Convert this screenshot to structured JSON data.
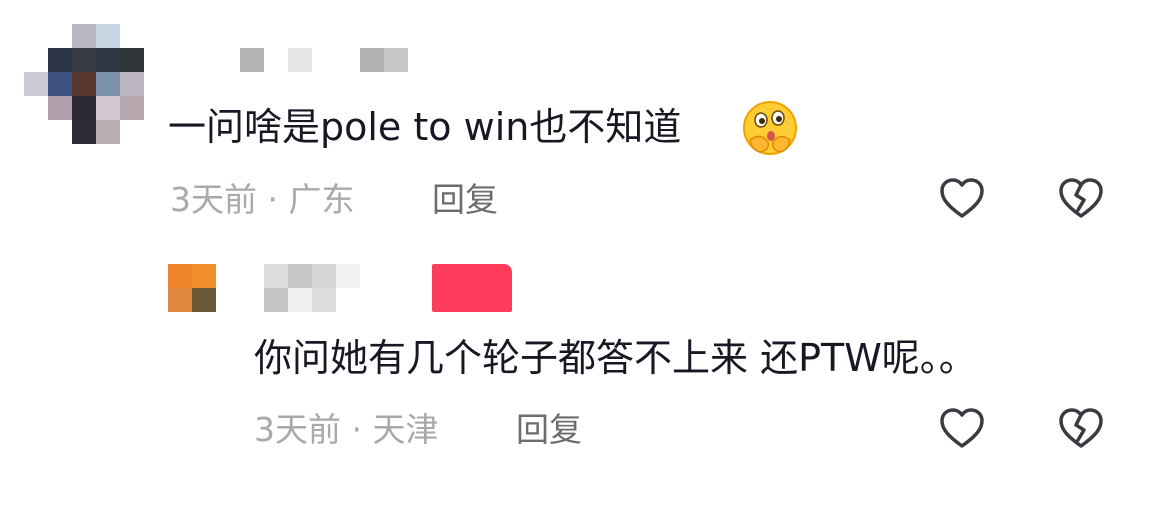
{
  "comments": [
    {
      "avatar": "pixelated-avatar",
      "username_hidden": true,
      "text": "一问啥是pole to win也不知道",
      "emoji": "thinking-kiss-emoji",
      "time": "3天前",
      "separator": "·",
      "location": "广东",
      "reply_label": "回复"
    },
    {
      "avatar": "pixelated-avatar-orange",
      "username_hidden": true,
      "text": "你问她有几个轮子都答不上来 还PTW呢。。",
      "time": "3天前",
      "separator": "·",
      "location": "天津",
      "reply_label": "回复"
    }
  ],
  "icons": {
    "like": "heart-outline-icon",
    "dislike": "broken-heart-icon"
  },
  "colors": {
    "text": "#161823",
    "meta": "#a8a8ad",
    "reply": "#6b6b70",
    "icon": "#3a3a40",
    "emoji_face": "#ffcc33",
    "pink_tag": "#ff3b5c"
  }
}
